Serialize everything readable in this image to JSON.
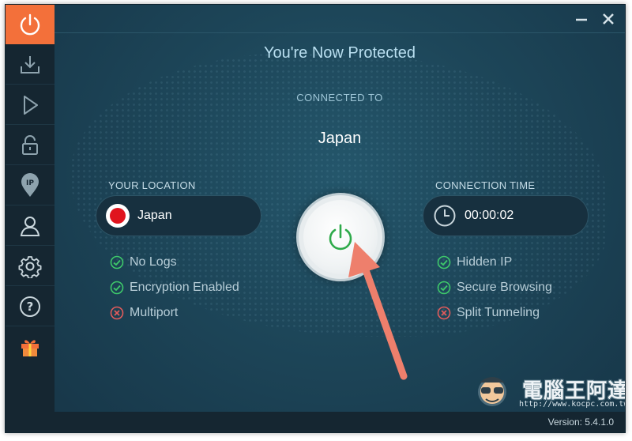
{
  "window": {
    "title": "You're Now Protected",
    "minimize_icon": "minimize-icon",
    "close_icon": "close-icon"
  },
  "sidebar": {
    "items": [
      {
        "icon": "power-icon",
        "active": true
      },
      {
        "icon": "download-icon"
      },
      {
        "icon": "play-icon"
      },
      {
        "icon": "unlock-icon"
      },
      {
        "icon": "ip-pin-icon"
      },
      {
        "icon": "user-icon"
      },
      {
        "icon": "gear-icon"
      },
      {
        "icon": "help-icon"
      },
      {
        "icon": "gift-icon"
      }
    ]
  },
  "connection": {
    "connected_to_label": "CONNECTED TO",
    "country": "Japan"
  },
  "location": {
    "label": "YOUR LOCATION",
    "value": "Japan",
    "flag_icon": "japan-flag-icon"
  },
  "time": {
    "label": "CONNECTION TIME",
    "value": "00:00:02",
    "clock_icon": "clock-icon"
  },
  "features_left": [
    {
      "label": "No Logs",
      "status": "enabled"
    },
    {
      "label": "Encryption Enabled",
      "status": "enabled"
    },
    {
      "label": "Multiport",
      "status": "disabled"
    }
  ],
  "features_right": [
    {
      "label": "Hidden IP",
      "status": "enabled"
    },
    {
      "label": "Secure Browsing",
      "status": "enabled"
    },
    {
      "label": "Split Tunneling",
      "status": "disabled"
    }
  ],
  "footer": {
    "version": "Version:  5.4.1.0"
  },
  "watermark": {
    "text": "電腦王阿達",
    "url": "http://www.kocpc.com.tw"
  },
  "colors": {
    "accent": "#f3703a",
    "sidebar_bg": "#152631",
    "main_bg": "#1d4659",
    "enabled_green": "#3ec96a",
    "disabled_red": "#e25b5b",
    "power_green": "#2eaa4a",
    "arrow": "#ee7f6c"
  }
}
